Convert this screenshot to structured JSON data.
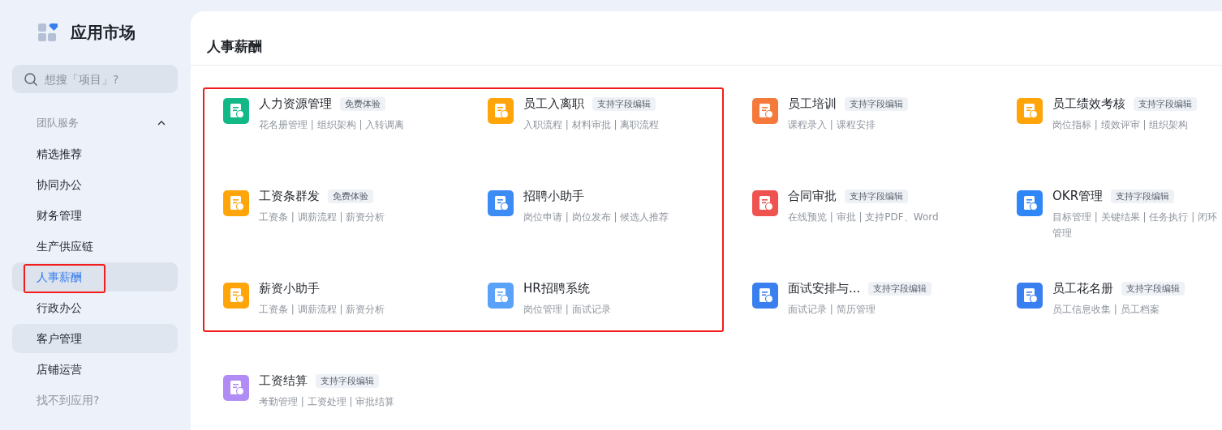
{
  "sidebar": {
    "title": "应用市场",
    "search": {
      "placeholder": "想搜「项目」?"
    },
    "group": {
      "label": "团队服务",
      "expanded": true
    },
    "items": [
      {
        "label": "精选推荐",
        "selected": false,
        "hovered": false
      },
      {
        "label": "协同办公",
        "selected": false,
        "hovered": false
      },
      {
        "label": "财务管理",
        "selected": false,
        "hovered": false
      },
      {
        "label": "生产供应链",
        "selected": false,
        "hovered": false
      },
      {
        "label": "人事薪酬",
        "selected": true,
        "hovered": false
      },
      {
        "label": "行政办公",
        "selected": false,
        "hovered": false
      },
      {
        "label": "客户管理",
        "selected": false,
        "hovered": true
      },
      {
        "label": "店铺运营",
        "selected": false,
        "hovered": false
      }
    ],
    "help_link": "找不到应用?"
  },
  "section": {
    "title": "人事薪酬"
  },
  "apps": [
    {
      "name": "人力资源管理",
      "tag": "免费体验",
      "desc": "花名册管理 | 组织架构 | 入转调离",
      "color": "#12b886"
    },
    {
      "name": "员工入离职",
      "tag": "支持字段编辑",
      "desc": "入职流程 | 材料审批 | 离职流程",
      "color": "#ffa50a"
    },
    {
      "name": "员工培训",
      "tag": "支持字段编辑",
      "desc": "课程录入 | 课程安排",
      "color": "#f5793b"
    },
    {
      "name": "员工绩效考核",
      "tag": "支持字段编辑",
      "desc": "岗位指标 | 绩效评审 | 组织架构",
      "color": "#ffa50a"
    },
    {
      "name": "工资条群发",
      "tag": "免费体验",
      "desc": "工资条 | 调薪流程 | 薪资分析",
      "color": "#ffa50a"
    },
    {
      "name": "招聘小助手",
      "desc": "岗位申请 | 岗位发布 | 候选人推荐",
      "color": "#3d8bf5"
    },
    {
      "name": "合同审批",
      "tag": "支持字段编辑",
      "desc": "在线预览 | 审批 | 支持PDF、Word",
      "color": "#ef5350"
    },
    {
      "name": "OKR管理",
      "tag": "支持字段编辑",
      "desc": "目标管理 | 关键结果 | 任务执行 | 闭环管理",
      "color": "#2f86f6"
    },
    {
      "name": "薪资小助手",
      "desc": "工资条 | 调薪流程 | 薪资分析",
      "color": "#ffa50a"
    },
    {
      "name": "HR招聘系统",
      "desc": "岗位管理 | 面试记录",
      "color": "#5aa2f7"
    },
    {
      "name": "面试安排与...",
      "tag": "支持字段编辑",
      "desc": "面试记录 | 简历管理",
      "color": "#3a7ff0"
    },
    {
      "name": "员工花名册",
      "tag": "支持字段编辑",
      "desc": "员工信息收集 | 员工档案",
      "color": "#3a7ff0"
    },
    {
      "name": "工资结算",
      "tag": "支持字段编辑",
      "desc": "考勤管理 | 工资处理 | 审批结算",
      "color": "#b18cf5"
    }
  ]
}
